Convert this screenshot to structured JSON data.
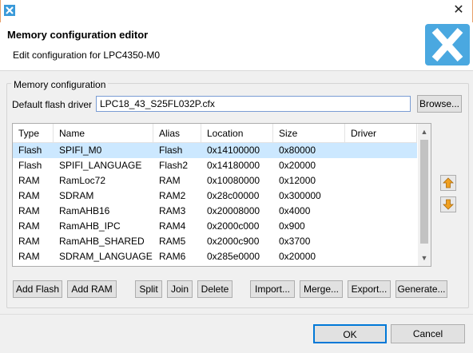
{
  "window": {
    "close_glyph": "✕"
  },
  "header": {
    "title": "Memory configuration editor",
    "subtitle": "Edit configuration for LPC4350-M0"
  },
  "memory": {
    "group_label": "Memory configuration",
    "flash_driver_label": "Default flash driver",
    "flash_driver_value": "LPC18_43_S25FL032P.cfx",
    "browse_label": "Browse..."
  },
  "table": {
    "headers": [
      "Type",
      "Name",
      "Alias",
      "Location",
      "Size",
      "Driver"
    ],
    "rows": [
      {
        "type": "Flash",
        "name": "SPIFI_M0",
        "alias": "Flash",
        "location": "0x14100000",
        "size": "0x80000",
        "driver": ""
      },
      {
        "type": "Flash",
        "name": "SPIFI_LANGUAGE",
        "alias": "Flash2",
        "location": "0x14180000",
        "size": "0x20000",
        "driver": ""
      },
      {
        "type": "RAM",
        "name": "RamLoc72",
        "alias": "RAM",
        "location": "0x10080000",
        "size": "0x12000",
        "driver": ""
      },
      {
        "type": "RAM",
        "name": "SDRAM",
        "alias": "RAM2",
        "location": "0x28c00000",
        "size": "0x300000",
        "driver": ""
      },
      {
        "type": "RAM",
        "name": "RamAHB16",
        "alias": "RAM3",
        "location": "0x20008000",
        "size": "0x4000",
        "driver": ""
      },
      {
        "type": "RAM",
        "name": "RamAHB_IPC",
        "alias": "RAM4",
        "location": "0x2000c000",
        "size": "0x900",
        "driver": ""
      },
      {
        "type": "RAM",
        "name": "RamAHB_SHARED",
        "alias": "RAM5",
        "location": "0x2000c900",
        "size": "0x3700",
        "driver": ""
      },
      {
        "type": "RAM",
        "name": "SDRAM_LANGUAGE",
        "alias": "RAM6",
        "location": "0x285e0000",
        "size": "0x20000",
        "driver": ""
      }
    ]
  },
  "actions": {
    "add_flash": "Add Flash",
    "add_ram": "Add RAM",
    "split": "Split",
    "join": "Join",
    "delete": "Delete",
    "import": "Import...",
    "merge": "Merge...",
    "export": "Export...",
    "generate": "Generate..."
  },
  "footer": {
    "ok": "OK",
    "cancel": "Cancel"
  },
  "colors": {
    "logo": "#4aa8e0",
    "selection": "#cce8ff",
    "move_arrow": "#f0a020"
  }
}
